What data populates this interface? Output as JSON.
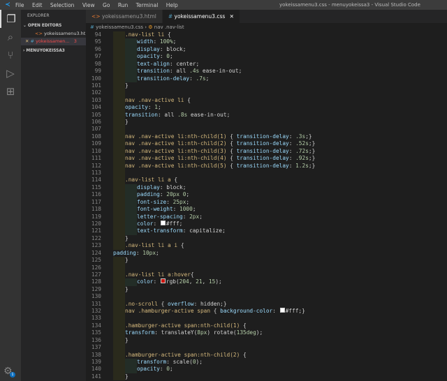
{
  "titlebar": {
    "menu": [
      "File",
      "Edit",
      "Selection",
      "View",
      "Go",
      "Run",
      "Terminal",
      "Help"
    ],
    "title": "yokeissamenu3.css - menuyokeissa3 - Visual Studio Code"
  },
  "sidebar": {
    "header": "EXPLORER",
    "open_editors": "OPEN EDITORS",
    "files": [
      {
        "name": "yokeissamenu3.ht...",
        "icon": "<>"
      },
      {
        "name": "yokeissamen...",
        "icon": "#",
        "errors": "3"
      }
    ],
    "folder": "MENUYOKEISSA3"
  },
  "tabs": [
    {
      "label": "yokeissamenu3.html",
      "icon": "<>"
    },
    {
      "label": "yokeissamenu3.css",
      "icon": "#"
    }
  ],
  "breadcrumb": {
    "file": "yokeissamenu3.css",
    "symbol": "nav .nav-list"
  },
  "gear_badge": "1",
  "colors": {
    "hover_red": "#cc150f",
    "white": "#ffffff"
  },
  "lines": [
    {
      "n": "94",
      "i": 1,
      "g": 1,
      "t": [
        [
          "sel",
          ".nav-list li "
        ],
        [
          "pun",
          "{"
        ]
      ]
    },
    {
      "n": "95",
      "i": 2,
      "g": 2,
      "t": [
        [
          "prop",
          "width"
        ],
        [
          "pun",
          ": "
        ],
        [
          "num",
          "100%"
        ],
        [
          "pun",
          ";"
        ]
      ]
    },
    {
      "n": "96",
      "i": 2,
      "g": 2,
      "t": [
        [
          "prop",
          "display"
        ],
        [
          "pun",
          ": "
        ],
        [
          "val",
          "block"
        ],
        [
          "pun",
          ";"
        ]
      ]
    },
    {
      "n": "97",
      "i": 2,
      "g": 2,
      "t": [
        [
          "prop",
          "opacity"
        ],
        [
          "pun",
          ": "
        ],
        [
          "num",
          "0"
        ],
        [
          "pun",
          ";"
        ]
      ]
    },
    {
      "n": "98",
      "i": 2,
      "g": 2,
      "t": [
        [
          "prop",
          "text-align"
        ],
        [
          "pun",
          ": "
        ],
        [
          "val",
          "center"
        ],
        [
          "pun",
          ";"
        ]
      ]
    },
    {
      "n": "99",
      "i": 2,
      "g": 2,
      "t": [
        [
          "prop",
          "transition"
        ],
        [
          "pun",
          ": "
        ],
        [
          "val",
          "all "
        ],
        [
          "num",
          ".4s"
        ],
        [
          "val",
          " ease-in-out"
        ],
        [
          "pun",
          ";"
        ]
      ]
    },
    {
      "n": "100",
      "i": 2,
      "g": 2,
      "t": [
        [
          "prop",
          "transition-delay"
        ],
        [
          "pun",
          ": "
        ],
        [
          "num",
          ".7s"
        ],
        [
          "pun",
          ";"
        ]
      ]
    },
    {
      "n": "101",
      "i": 1,
      "g": 1,
      "t": [
        [
          "pun",
          "}"
        ]
      ]
    },
    {
      "n": "102",
      "i": 1,
      "g": 1,
      "t": []
    },
    {
      "n": "103",
      "i": 1,
      "g": 1,
      "t": [
        [
          "sel",
          "nav .nav-active li "
        ],
        [
          "pun",
          "{"
        ]
      ]
    },
    {
      "n": "104",
      "i": 1,
      "g": 1,
      "t": [
        [
          "prop",
          "opacity"
        ],
        [
          "pun",
          ": "
        ],
        [
          "num",
          "1"
        ],
        [
          "pun",
          ";"
        ]
      ]
    },
    {
      "n": "105",
      "i": 1,
      "g": 1,
      "t": [
        [
          "prop",
          "transition"
        ],
        [
          "pun",
          ": "
        ],
        [
          "val",
          "all "
        ],
        [
          "num",
          ".8s"
        ],
        [
          "val",
          " ease-in-out"
        ],
        [
          "pun",
          ";"
        ]
      ]
    },
    {
      "n": "106",
      "i": 1,
      "g": 1,
      "t": [
        [
          "pun",
          "}"
        ]
      ]
    },
    {
      "n": "107",
      "i": 1,
      "g": 1,
      "t": []
    },
    {
      "n": "108",
      "i": 1,
      "g": 1,
      "t": [
        [
          "sel",
          "nav .nav-active li:nth-child(1) "
        ],
        [
          "pun",
          "{ "
        ],
        [
          "prop",
          "transition-delay"
        ],
        [
          "pun",
          ": "
        ],
        [
          "num",
          ".3s"
        ],
        [
          "pun",
          ";}"
        ]
      ]
    },
    {
      "n": "109",
      "i": 1,
      "g": 1,
      "t": [
        [
          "sel",
          "nav .nav-active li:nth-child(2) "
        ],
        [
          "pun",
          "{ "
        ],
        [
          "prop",
          "transition-delay"
        ],
        [
          "pun",
          ": "
        ],
        [
          "num",
          ".52s"
        ],
        [
          "pun",
          ";}"
        ]
      ]
    },
    {
      "n": "110",
      "i": 1,
      "g": 1,
      "t": [
        [
          "sel",
          "nav .nav-active li:nth-child(3) "
        ],
        [
          "pun",
          "{ "
        ],
        [
          "prop",
          "transition-delay"
        ],
        [
          "pun",
          ": "
        ],
        [
          "num",
          ".72s"
        ],
        [
          "pun",
          ";}"
        ]
      ]
    },
    {
      "n": "111",
      "i": 1,
      "g": 1,
      "t": [
        [
          "sel",
          "nav .nav-active li:nth-child(4) "
        ],
        [
          "pun",
          "{ "
        ],
        [
          "prop",
          "transition-delay"
        ],
        [
          "pun",
          ": "
        ],
        [
          "num",
          ".92s"
        ],
        [
          "pun",
          ";}"
        ]
      ]
    },
    {
      "n": "112",
      "i": 1,
      "g": 1,
      "t": [
        [
          "sel",
          "nav .nav-active li:nth-child(5) "
        ],
        [
          "pun",
          "{ "
        ],
        [
          "prop",
          "transition-delay"
        ],
        [
          "pun",
          ": "
        ],
        [
          "num",
          "1.2s"
        ],
        [
          "pun",
          ";}"
        ]
      ]
    },
    {
      "n": "113",
      "i": 1,
      "g": 1,
      "t": []
    },
    {
      "n": "114",
      "i": 1,
      "g": 1,
      "t": [
        [
          "sel",
          ".nav-list li a "
        ],
        [
          "pun",
          "{"
        ]
      ]
    },
    {
      "n": "115",
      "i": 2,
      "g": 2,
      "t": [
        [
          "prop",
          "display"
        ],
        [
          "pun",
          ": "
        ],
        [
          "val",
          "block"
        ],
        [
          "pun",
          ";"
        ]
      ]
    },
    {
      "n": "116",
      "i": 2,
      "g": 2,
      "t": [
        [
          "prop",
          "padding"
        ],
        [
          "pun",
          ": "
        ],
        [
          "num",
          "20px 0"
        ],
        [
          "pun",
          ";"
        ]
      ]
    },
    {
      "n": "117",
      "i": 2,
      "g": 2,
      "t": [
        [
          "prop",
          "font-size"
        ],
        [
          "pun",
          ": "
        ],
        [
          "num",
          "25px"
        ],
        [
          "pun",
          ";"
        ]
      ]
    },
    {
      "n": "118",
      "i": 2,
      "g": 2,
      "t": [
        [
          "prop",
          "font-weight"
        ],
        [
          "pun",
          ": "
        ],
        [
          "num",
          "1000"
        ],
        [
          "pun",
          ";"
        ]
      ]
    },
    {
      "n": "119",
      "i": 2,
      "g": 2,
      "t": [
        [
          "prop",
          "letter-spacing"
        ],
        [
          "pun",
          ": "
        ],
        [
          "num",
          "2px"
        ],
        [
          "pun",
          ";"
        ]
      ]
    },
    {
      "n": "120",
      "i": 2,
      "g": 2,
      "t": [
        [
          "prop",
          "color"
        ],
        [
          "pun",
          ": "
        ],
        [
          "swatch",
          "#ffffff"
        ],
        [
          "val",
          "#fff"
        ],
        [
          "pun",
          ";"
        ]
      ]
    },
    {
      "n": "121",
      "i": 2,
      "g": 2,
      "t": [
        [
          "prop",
          "text-transform"
        ],
        [
          "pun",
          ": "
        ],
        [
          "val",
          "capitalize"
        ],
        [
          "pun",
          ";"
        ]
      ]
    },
    {
      "n": "122",
      "i": 1,
      "g": 1,
      "t": [
        [
          "pun",
          "}"
        ]
      ]
    },
    {
      "n": "123",
      "i": 1,
      "g": 1,
      "t": [
        [
          "sel",
          ".nav-list li a i "
        ],
        [
          "pun",
          "{"
        ]
      ]
    },
    {
      "n": "124",
      "i": 0,
      "g": 0,
      "t": [
        [
          "prop",
          "padding"
        ],
        [
          "pun",
          ": "
        ],
        [
          "num",
          "10px"
        ],
        [
          "pun",
          ";"
        ]
      ]
    },
    {
      "n": "125",
      "i": 1,
      "g": 1,
      "t": [
        [
          "pun",
          "}"
        ]
      ]
    },
    {
      "n": "126",
      "i": 1,
      "g": 1,
      "t": []
    },
    {
      "n": "127",
      "i": 1,
      "g": 1,
      "t": [
        [
          "sel",
          ".nav-list li a:hover"
        ],
        [
          "pun",
          "{"
        ]
      ]
    },
    {
      "n": "128",
      "i": 2,
      "g": 2,
      "t": [
        [
          "prop",
          "color"
        ],
        [
          "pun",
          ": "
        ],
        [
          "swatch",
          "#cc150f"
        ],
        [
          "val",
          "rgb("
        ],
        [
          "num",
          "204"
        ],
        [
          "val",
          ", "
        ],
        [
          "num",
          "21"
        ],
        [
          "val",
          ", "
        ],
        [
          "num",
          "15"
        ],
        [
          "val",
          ")"
        ],
        [
          "pun",
          ";"
        ]
      ]
    },
    {
      "n": "129",
      "i": 1,
      "g": 1,
      "t": [
        [
          "pun",
          "}"
        ]
      ]
    },
    {
      "n": "130",
      "i": 1,
      "g": 1,
      "t": []
    },
    {
      "n": "131",
      "i": 1,
      "g": 1,
      "t": [
        [
          "sel",
          ".no-scroll "
        ],
        [
          "pun",
          "{ "
        ],
        [
          "prop",
          "overflow"
        ],
        [
          "pun",
          ": "
        ],
        [
          "val",
          "hidden"
        ],
        [
          "pun",
          ";}"
        ]
      ]
    },
    {
      "n": "132",
      "i": 1,
      "g": 1,
      "t": [
        [
          "sel",
          "nav .hamburger-active span "
        ],
        [
          "pun",
          "{ "
        ],
        [
          "prop",
          "background-color"
        ],
        [
          "pun",
          ": "
        ],
        [
          "swatch",
          "#ffffff"
        ],
        [
          "val",
          "#fff"
        ],
        [
          "pun",
          ";}"
        ]
      ]
    },
    {
      "n": "133",
      "i": 1,
      "g": 1,
      "t": []
    },
    {
      "n": "134",
      "i": 1,
      "g": 1,
      "t": [
        [
          "sel",
          ".hamburger-active span:nth-child(1) "
        ],
        [
          "pun",
          "{"
        ]
      ]
    },
    {
      "n": "135",
      "i": 1,
      "g": 1,
      "t": [
        [
          "prop",
          "transform"
        ],
        [
          "pun",
          ": "
        ],
        [
          "val",
          "translateY("
        ],
        [
          "num",
          "8px"
        ],
        [
          "val",
          ") rotate("
        ],
        [
          "num",
          "135deg"
        ],
        [
          "val",
          ")"
        ],
        [
          "pun",
          ";"
        ]
      ]
    },
    {
      "n": "136",
      "i": 1,
      "g": 1,
      "t": [
        [
          "pun",
          "}"
        ]
      ]
    },
    {
      "n": "137",
      "i": 1,
      "g": 1,
      "t": []
    },
    {
      "n": "138",
      "i": 1,
      "g": 1,
      "t": [
        [
          "sel",
          ".hamburger-active span:nth-child(2) "
        ],
        [
          "pun",
          "{"
        ]
      ]
    },
    {
      "n": "139",
      "i": 2,
      "g": 2,
      "t": [
        [
          "prop",
          "transform"
        ],
        [
          "pun",
          ": "
        ],
        [
          "val",
          "scale("
        ],
        [
          "num",
          "0"
        ],
        [
          "val",
          ")"
        ],
        [
          "pun",
          ";"
        ]
      ]
    },
    {
      "n": "140",
      "i": 2,
      "g": 2,
      "t": [
        [
          "prop",
          "opacity"
        ],
        [
          "pun",
          ": "
        ],
        [
          "num",
          "0"
        ],
        [
          "pun",
          ";"
        ]
      ]
    },
    {
      "n": "141",
      "i": 1,
      "g": 1,
      "t": [
        [
          "pun",
          "}"
        ]
      ]
    }
  ]
}
